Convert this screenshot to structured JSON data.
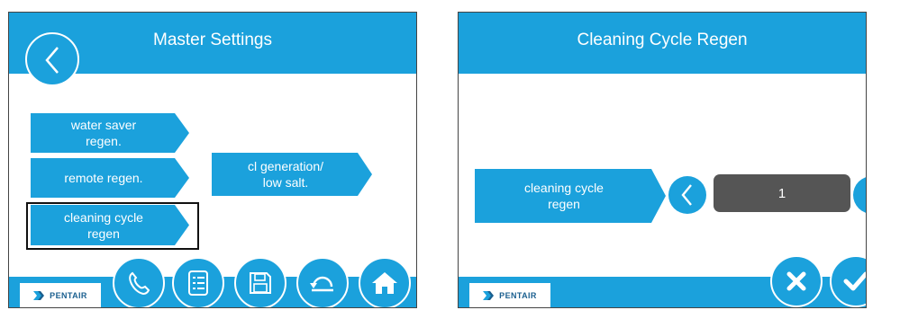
{
  "left_screen": {
    "title": "Master Settings",
    "buttons": {
      "water_saver": "water saver\nregen.",
      "remote": "remote regen.",
      "cleaning_cycle": "cleaning cycle\nregen",
      "cl_generation": "cl generation/\nlow salt."
    },
    "bottom_icons": [
      "phone-icon",
      "list-icon",
      "save-icon",
      "undo-icon",
      "home-icon"
    ]
  },
  "right_screen": {
    "title": "Cleaning Cycle Regen",
    "setting_label": "cleaning cycle\nregen",
    "setting_value": "1",
    "bottom_icons": [
      "cancel-icon",
      "confirm-icon"
    ]
  },
  "brand": {
    "logo_text": "PENTAIR"
  },
  "colors": {
    "accent": "#1ba1dc",
    "value_box": "#555555",
    "logo_text": "#1a5f8f"
  }
}
